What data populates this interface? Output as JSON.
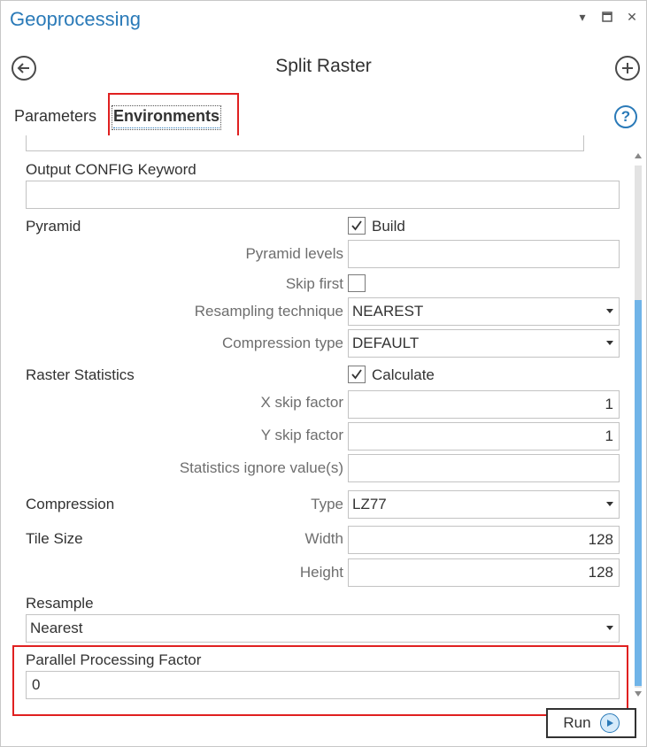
{
  "pane": {
    "title": "Geoprocessing"
  },
  "tool": {
    "title": "Split Raster"
  },
  "tabs": {
    "parameters": "Parameters",
    "environments": "Environments"
  },
  "help": {
    "glyph": "?"
  },
  "env": {
    "output_config_keyword": {
      "label": "Output CONFIG Keyword",
      "value": ""
    },
    "pyramid": {
      "label": "Pyramid",
      "build_label": "Build",
      "build_checked": true,
      "levels_label": "Pyramid levels",
      "levels_value": "",
      "skip_first_label": "Skip first",
      "skip_first_checked": false,
      "resampling_label": "Resampling technique",
      "resampling_value": "NEAREST",
      "compression_label": "Compression type",
      "compression_value": "DEFAULT"
    },
    "raster_statistics": {
      "label": "Raster Statistics",
      "calculate_label": "Calculate",
      "calculate_checked": true,
      "x_skip_label": "X skip factor",
      "x_skip_value": "1",
      "y_skip_label": "Y skip factor",
      "y_skip_value": "1",
      "ignore_label": "Statistics ignore value(s)",
      "ignore_value": ""
    },
    "compression": {
      "label": "Compression",
      "type_label": "Type",
      "type_value": "LZ77"
    },
    "tile_size": {
      "label": "Tile Size",
      "width_label": "Width",
      "width_value": "128",
      "height_label": "Height",
      "height_value": "128"
    },
    "resample": {
      "label": "Resample",
      "value": "Nearest"
    },
    "parallel": {
      "label": "Parallel Processing Factor",
      "value": "0"
    }
  },
  "run": {
    "label": "Run"
  },
  "icons": [
    "back-icon",
    "add-icon",
    "help-icon",
    "pin-icon",
    "maximize-icon",
    "close-icon",
    "checkmark-icon",
    "play-icon",
    "dropdown-caret-icon"
  ],
  "colors": {
    "accent": "#2a7ab8",
    "highlight": "#e02020",
    "scroll_thumb": "#70b4e8"
  }
}
